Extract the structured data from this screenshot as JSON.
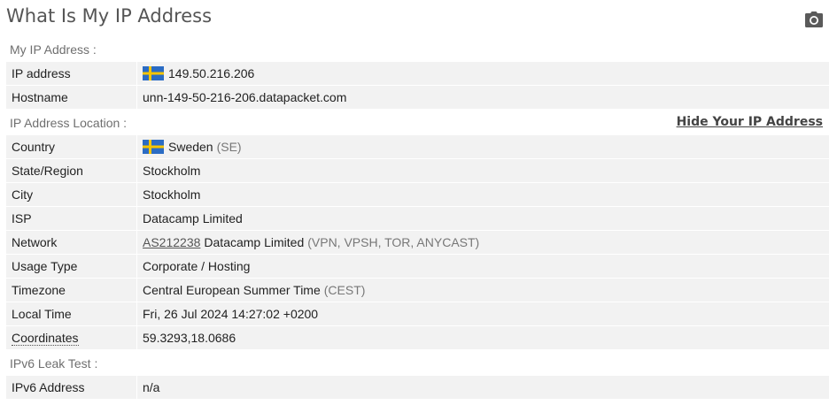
{
  "header": {
    "title": "What Is My IP Address",
    "camera_icon": "camera-icon"
  },
  "my_ip_section": {
    "heading": "My IP Address :",
    "rows": [
      {
        "label": "IP address",
        "value": "149.50.216.206",
        "flag": "sweden-flag-icon"
      },
      {
        "label": "Hostname",
        "value": "unn-149-50-216-206.datapacket.com"
      }
    ]
  },
  "location_section": {
    "heading": "IP Address Location :",
    "hide_link": "Hide Your IP Address",
    "country": {
      "label": "Country",
      "value": "Sweden",
      "code": "(SE)",
      "flag": "sweden-flag-icon"
    },
    "state": {
      "label": "State/Region",
      "value": "Stockholm"
    },
    "city": {
      "label": "City",
      "value": "Stockholm"
    },
    "isp": {
      "label": "ISP",
      "value": "Datacamp Limited"
    },
    "network": {
      "label": "Network",
      "asn": "AS212238",
      "value": "Datacamp Limited",
      "tags": "(VPN, VPSH, TOR, ANYCAST)"
    },
    "usage": {
      "label": "Usage Type",
      "value": "Corporate / Hosting"
    },
    "timezone": {
      "label": "Timezone",
      "value": "Central European Summer Time",
      "abbr": "(CEST)"
    },
    "local_time": {
      "label": "Local Time",
      "value": "Fri, 26 Jul 2024 14:27:02 +0200"
    },
    "coordinates": {
      "label": "Coordinates",
      "value": "59.3293,18.0686"
    }
  },
  "ipv6_section": {
    "heading": "IPv6 Leak Test :",
    "ipv6": {
      "label": "IPv6 Address",
      "value": "n/a"
    }
  },
  "colors": {
    "row_background": "#f2f2f2",
    "flag_blue": "#2b6cc4",
    "flag_yellow": "#f6c500"
  }
}
